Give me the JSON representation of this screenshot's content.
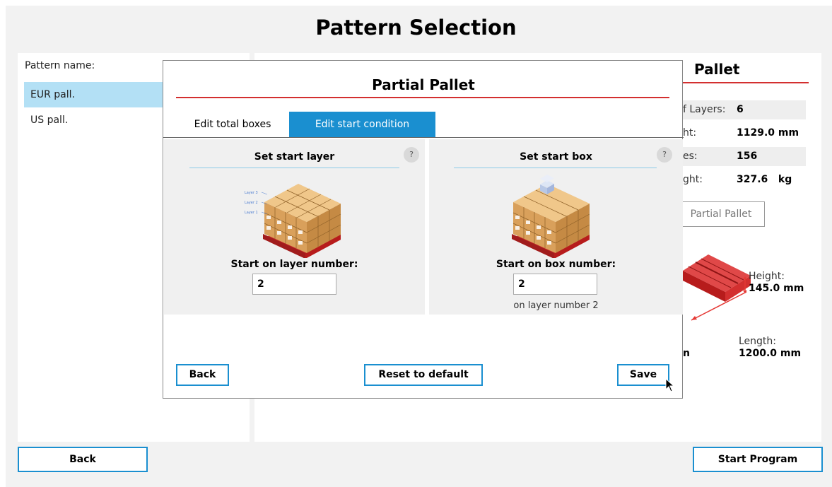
{
  "page": {
    "title": "Pattern Selection"
  },
  "patterns": {
    "label": "Pattern name:",
    "items": [
      {
        "label": "EUR pall.",
        "selected": true
      },
      {
        "label": "US pall.",
        "selected": false
      }
    ]
  },
  "pallet_info": {
    "title": "Pallet",
    "rows": [
      {
        "key": "f Layers:",
        "value": "6"
      },
      {
        "key": "ht:",
        "value": "1129.0 mm"
      },
      {
        "key": "es:",
        "value": "156"
      },
      {
        "key": "ght:",
        "value": "327.6   kg"
      }
    ],
    "partial_button": "Partial Pallet",
    "height_label": "Height:",
    "height_value": "145.0 mm",
    "length_label": "Length:",
    "length_value": "1200.0 mm",
    "truncated_unit": "n"
  },
  "footer": {
    "back": "Back",
    "start": "Start Program"
  },
  "dialog": {
    "title": "Partial Pallet",
    "tabs": [
      {
        "label": "Edit total boxes",
        "active": false
      },
      {
        "label": "Edit start condition",
        "active": true
      }
    ],
    "start_layer": {
      "title": "Set start layer",
      "help": "?",
      "field_label": "Start on layer number:",
      "value": "2",
      "layer_tags": [
        "Layer 3",
        "Layer 2",
        "Layer 1"
      ]
    },
    "start_box": {
      "title": "Set start box",
      "help": "?",
      "field_label": "Start on box number:",
      "value": "2",
      "note": "on layer number 2"
    },
    "buttons": {
      "back": "Back",
      "reset": "Reset to default",
      "save": "Save"
    }
  },
  "colors": {
    "accent": "#1a8fd0",
    "divider": "#d32f2f",
    "selection": "#b3e0f5",
    "pallet": "#c62828",
    "box": "#d9a05b"
  }
}
